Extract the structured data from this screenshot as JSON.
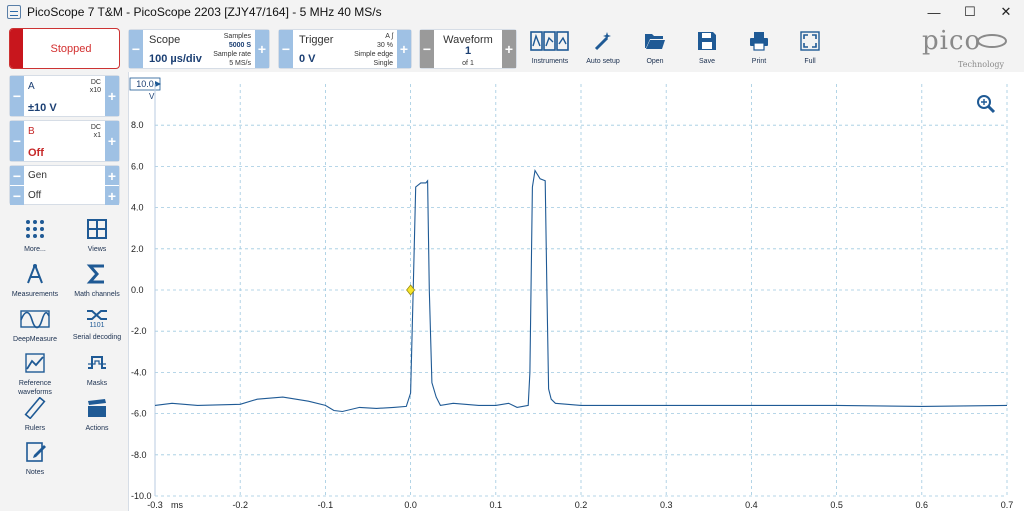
{
  "window": {
    "title": "PicoScope 7 T&M  - PicoScope 2203 [ZJY47/164] - 5 MHz 40 MS/s",
    "minimize": "—",
    "maximize": "☐",
    "close": "✕"
  },
  "run": {
    "status": "Stopped"
  },
  "scope_group": {
    "title": "Scope",
    "value": "100 µs/div",
    "samples_label": "Samples",
    "samples_value": "5000 S",
    "rate_label": "Sample rate",
    "rate_value": "5 MS/s"
  },
  "trigger_group": {
    "title": "Trigger",
    "value": "0 V",
    "channel": "A",
    "percent": "30 %",
    "type": "Simple edge",
    "mode": "Single"
  },
  "waveform_group": {
    "title": "Waveform",
    "value": "1",
    "of": "of 1"
  },
  "toolbar": {
    "instruments": "Instruments",
    "auto_setup": "Auto setup",
    "open": "Open",
    "save": "Save",
    "print": "Print",
    "full": "Full"
  },
  "logo": {
    "word": "pico",
    "sub": "Technology"
  },
  "channels": [
    {
      "name": "A",
      "coupling": "DC",
      "probe": "x10",
      "range": "±10 V",
      "color": "#1f5a95"
    },
    {
      "name": "B",
      "coupling": "DC",
      "probe": "x1",
      "range": "Off",
      "color": "#c62828"
    }
  ],
  "generator": {
    "name": "Gen",
    "state": "Off"
  },
  "tools": [
    {
      "label": "More...",
      "icon": "dots-grid-icon"
    },
    {
      "label": "Views",
      "icon": "views-grid-icon"
    },
    {
      "label": "Measurements",
      "icon": "compass-icon"
    },
    {
      "label": "Math channels",
      "icon": "sigma-icon"
    },
    {
      "label": "DeepMeasure",
      "icon": "deepmeasure-icon"
    },
    {
      "label": "Serial decoding",
      "icon": "serial-decoding-icon"
    },
    {
      "label": "Reference waveforms",
      "icon": "reference-waveforms-icon"
    },
    {
      "label": "Masks",
      "icon": "masks-icon"
    },
    {
      "label": "Rulers",
      "icon": "ruler-icon"
    },
    {
      "label": "Actions",
      "icon": "clapper-icon"
    },
    {
      "label": "Notes",
      "icon": "notes-icon"
    }
  ],
  "serial_icon_text": "1101",
  "axis": {
    "y_unit": "V",
    "y_top_box": "10.0",
    "y_ticks": [
      "8.0",
      "6.0",
      "4.0",
      "2.0",
      "0.0",
      "-2.0",
      "-4.0",
      "-6.0",
      "-8.0",
      "-10.0"
    ],
    "x_unit": "ms",
    "x_ticks": [
      "-0.3",
      "-0.2",
      "-0.1",
      "0.0",
      "0.1",
      "0.2",
      "0.3",
      "0.4",
      "0.5",
      "0.6",
      "0.7"
    ]
  },
  "chart_data": {
    "type": "line",
    "xlabel": "ms",
    "ylabel": "V",
    "xlim": [
      -0.3,
      0.7
    ],
    "ylim": [
      -10,
      10
    ],
    "grid": true,
    "trigger_point": {
      "x": 0.0,
      "y": 0.0
    },
    "series": [
      {
        "color": "#1f5a95",
        "x": [
          -0.3,
          -0.28,
          -0.25,
          -0.2,
          -0.18,
          -0.15,
          -0.12,
          -0.1,
          -0.09,
          -0.08,
          -0.06,
          -0.04,
          -0.02,
          -0.005,
          0.0,
          0.003,
          0.006,
          0.012,
          0.018,
          0.02,
          0.022,
          0.025,
          0.03,
          0.035,
          0.05,
          0.08,
          0.1,
          0.115,
          0.125,
          0.138,
          0.14,
          0.143,
          0.146,
          0.152,
          0.158,
          0.16,
          0.162,
          0.165,
          0.17,
          0.2,
          0.3,
          0.4,
          0.5,
          0.6,
          0.7
        ],
        "y": [
          -5.6,
          -5.5,
          -5.6,
          -5.55,
          -5.3,
          -5.2,
          -5.4,
          -5.6,
          -5.85,
          -5.9,
          -5.7,
          -5.75,
          -5.7,
          -5.65,
          -5.0,
          0.0,
          5.0,
          5.2,
          5.2,
          5.3,
          0.0,
          -4.5,
          -5.2,
          -5.6,
          -5.5,
          -5.6,
          -5.6,
          -5.5,
          -5.7,
          -5.6,
          -4.0,
          5.0,
          5.8,
          5.4,
          5.3,
          0.0,
          -4.8,
          -5.3,
          -5.5,
          -5.6,
          -5.6,
          -5.6,
          -5.6,
          -5.65,
          -5.6
        ]
      }
    ]
  }
}
